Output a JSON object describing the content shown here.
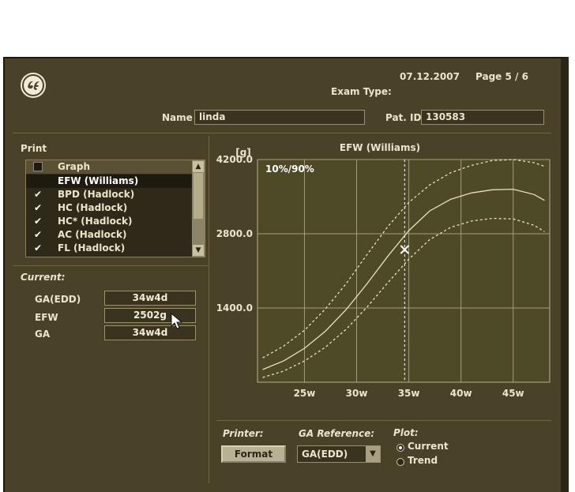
{
  "header": {
    "date": "07.12.2007",
    "page": "Page  5 / 6",
    "exam_type_label": "Exam Type:",
    "name_label": "Name",
    "name_value": "linda",
    "patid_label": "Pat. ID",
    "patid_value": "130583"
  },
  "print": {
    "label": "Print",
    "header": "Graph",
    "items": [
      {
        "label": "EFW (Williams)",
        "checked": false,
        "selected": true
      },
      {
        "label": "BPD (Hadlock)",
        "checked": true
      },
      {
        "label": "HC (Hadlock)",
        "checked": true
      },
      {
        "label": "HC* (Hadlock)",
        "checked": true
      },
      {
        "label": "AC (Hadlock)",
        "checked": true
      },
      {
        "label": "FL (Hadlock)",
        "checked": true
      }
    ]
  },
  "current": {
    "label": "Current:",
    "rows": [
      {
        "label": "GA(EDD)",
        "value": "34w4d"
      },
      {
        "label": "EFW",
        "value": "2502g"
      },
      {
        "label": "GA",
        "value": "34w4d"
      }
    ]
  },
  "controls": {
    "printer_label": "Printer:",
    "format_button": "Format",
    "ga_reference_label": "GA Reference:",
    "ga_reference_value": "GA(EDD)",
    "plot_label": "Plot:",
    "plot_options": [
      {
        "label": "Current",
        "selected": true
      },
      {
        "label": "Trend",
        "selected": false
      }
    ]
  },
  "colors": {
    "background": "#4a4228",
    "plot_area": "#4e4a28",
    "curve": "#e8e0c4"
  },
  "chart_data": {
    "type": "line",
    "title": "EFW (Williams)",
    "ylabel": "[g]",
    "annotation": "10%/90%",
    "x_ticks": [
      25,
      30,
      35,
      40,
      45
    ],
    "x_tick_labels": [
      "25w",
      "30w",
      "35w",
      "40w",
      "45w"
    ],
    "y_ticks": [
      1400,
      2800,
      4200
    ],
    "y_tick_labels": [
      "1400.0",
      "2800.0",
      "4200.0"
    ],
    "xlim": [
      20.5,
      48.5
    ],
    "ylim": [
      0,
      4200
    ],
    "grid": true,
    "series": [
      {
        "style": "dashed",
        "x": [
          21,
          23,
          25,
          27,
          29,
          31,
          33,
          35,
          37,
          39,
          41,
          43,
          45,
          47,
          48
        ],
        "y": [
          460,
          680,
          980,
          1380,
          1860,
          2410,
          2940,
          3390,
          3720,
          3950,
          4090,
          4180,
          4200,
          4140,
          4070
        ]
      },
      {
        "style": "solid",
        "x": [
          21,
          23,
          25,
          27,
          29,
          31,
          33,
          35,
          37,
          39,
          41,
          43,
          45,
          47,
          48
        ],
        "y": [
          240,
          400,
          640,
          960,
          1370,
          1860,
          2380,
          2860,
          3230,
          3450,
          3570,
          3630,
          3640,
          3540,
          3430
        ]
      },
      {
        "style": "dashed",
        "x": [
          21,
          23,
          25,
          27,
          29,
          31,
          33,
          35,
          37,
          39,
          41,
          43,
          45,
          47,
          48
        ],
        "y": [
          90,
          210,
          400,
          660,
          1000,
          1420,
          1880,
          2320,
          2690,
          2920,
          3040,
          3090,
          3080,
          2960,
          2840
        ]
      }
    ],
    "marker": {
      "x": 34.6,
      "y": 2502,
      "symbol": "x"
    },
    "cursor_x": 34.6
  }
}
